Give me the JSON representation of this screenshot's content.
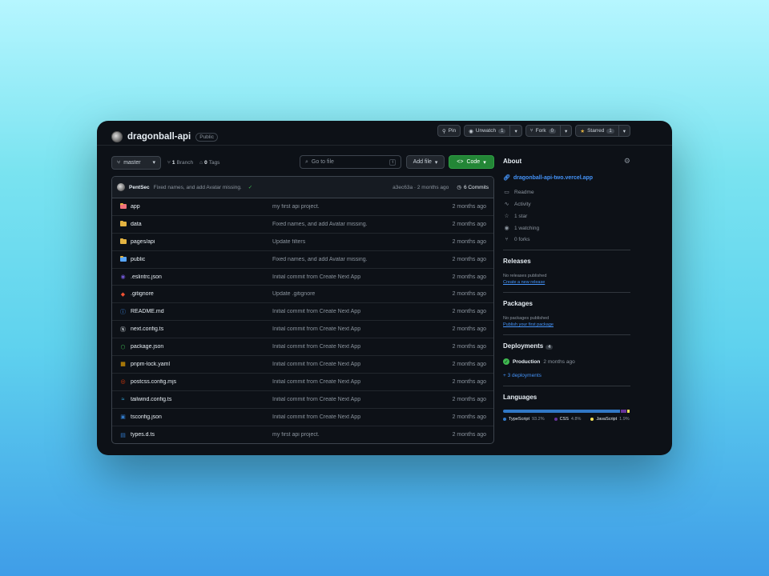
{
  "repo": {
    "name": "dragonball-api",
    "visibility": "Public"
  },
  "header_actions": {
    "pin": "Pin",
    "unwatch": "Unwatch",
    "watch_count": "1",
    "fork": "Fork",
    "fork_count": "0",
    "starred": "Starred",
    "star_count": "1"
  },
  "toolbar": {
    "branch": "master",
    "branch_count": "1",
    "branch_label": "Branch",
    "tag_count": "0",
    "tag_label": "Tags",
    "search_placeholder": "Go to file",
    "search_kbd": "t",
    "add_file": "Add file",
    "code": "Code"
  },
  "commit": {
    "user": "PentSec",
    "message": "Fixed names, and add Avatar missing.",
    "hash_time": "a3ec63a · 2 months ago",
    "count_label": "6 Commits"
  },
  "files": [
    {
      "name": "app",
      "type": "folder-red",
      "message": "my first api project.",
      "date": "2 months ago"
    },
    {
      "name": "data",
      "type": "folder",
      "message": "Fixed names, and add Avatar missing.",
      "date": "2 months ago"
    },
    {
      "name": "pages/api",
      "type": "folder",
      "message": "Update filters",
      "date": "2 months ago"
    },
    {
      "name": "public",
      "type": "folder-blue",
      "message": "Fixed names, and add Avatar missing.",
      "date": "2 months ago"
    },
    {
      "name": ".eslintrc.json",
      "type": "eslint",
      "message": "Initial commit from Create Next App",
      "date": "2 months ago"
    },
    {
      "name": ".gitignore",
      "type": "git",
      "message": "Update .gitignore",
      "date": "2 months ago"
    },
    {
      "name": "README.md",
      "type": "info",
      "message": "Initial commit from Create Next App",
      "date": "2 months ago"
    },
    {
      "name": "next.config.ts",
      "type": "next",
      "message": "Initial commit from Create Next App",
      "date": "2 months ago"
    },
    {
      "name": "package.json",
      "type": "node",
      "message": "Initial commit from Create Next App",
      "date": "2 months ago"
    },
    {
      "name": "pnpm-lock.yaml",
      "type": "pnpm",
      "message": "Initial commit from Create Next App",
      "date": "2 months ago"
    },
    {
      "name": "postcss.config.mjs",
      "type": "postcss",
      "message": "Initial commit from Create Next App",
      "date": "2 months ago"
    },
    {
      "name": "tailwind.config.ts",
      "type": "tailwind",
      "message": "Initial commit from Create Next App",
      "date": "2 months ago"
    },
    {
      "name": "tsconfig.json",
      "type": "ts",
      "message": "Initial commit from Create Next App",
      "date": "2 months ago"
    },
    {
      "name": "types.d.ts",
      "type": "dts",
      "message": "my first api project.",
      "date": "2 months ago"
    }
  ],
  "sidebar": {
    "about_title": "About",
    "website": "dragonball-api-two.vercel.app",
    "readme": "Readme",
    "activity": "Activity",
    "stars": "1 star",
    "watching": "1 watching",
    "forks": "0 forks",
    "releases_title": "Releases",
    "releases_none": "No releases published",
    "releases_link": "Create a new release",
    "packages_title": "Packages",
    "packages_none": "No packages published",
    "packages_link": "Publish your first package",
    "deployments_title": "Deployments",
    "deployments_count": "4",
    "deploy_env": "Production",
    "deploy_time": "2 months ago",
    "deploy_more": "+ 3 deployments",
    "languages_title": "Languages",
    "languages": [
      {
        "name": "TypeScript",
        "percent": "93.2%",
        "value": 93.2,
        "color": "#3178c6"
      },
      {
        "name": "CSS",
        "percent": "4.8%",
        "value": 4.8,
        "color": "#663399"
      },
      {
        "name": "JavaScript",
        "percent": "1.9%",
        "value": 1.9,
        "color": "#f1e05a"
      }
    ]
  }
}
